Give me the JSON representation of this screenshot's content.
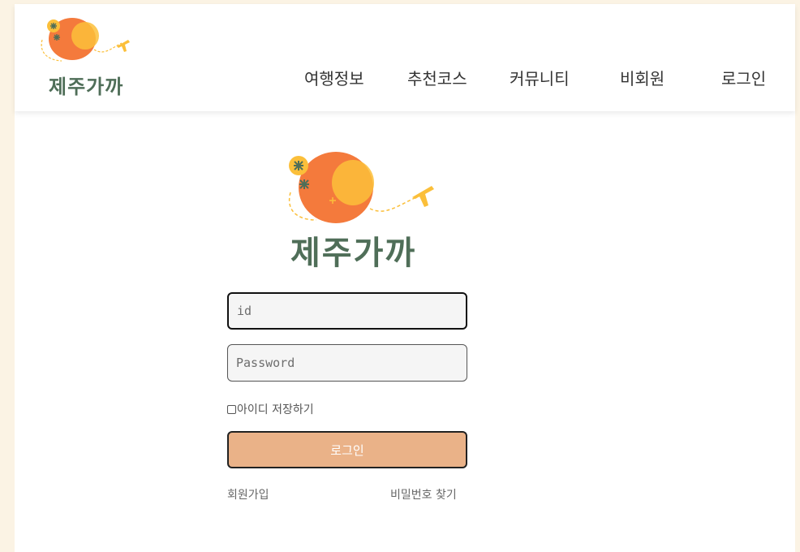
{
  "header": {
    "logo_text": "제주가까",
    "nav": [
      {
        "label": "여행정보"
      },
      {
        "label": "추천코스"
      },
      {
        "label": "커뮤니티"
      },
      {
        "label": "비회원"
      },
      {
        "label": "로그인"
      }
    ]
  },
  "main": {
    "logo_text": "제주가까",
    "id_field": {
      "value": "",
      "placeholder": "id"
    },
    "password_field": {
      "value": "",
      "placeholder": "Password"
    },
    "remember_label": "아이디 저장하기",
    "remember_checked": false,
    "login_button": "로그인",
    "signup_link": "회원가입",
    "find_password_link": "비밀번호 찾기"
  },
  "colors": {
    "page_background": "#fbf3e4",
    "logo_green": "#4f6e58",
    "logo_orange": "#f47a3c",
    "logo_yellow": "#fbbf3a",
    "button_fill": "#eab288"
  }
}
